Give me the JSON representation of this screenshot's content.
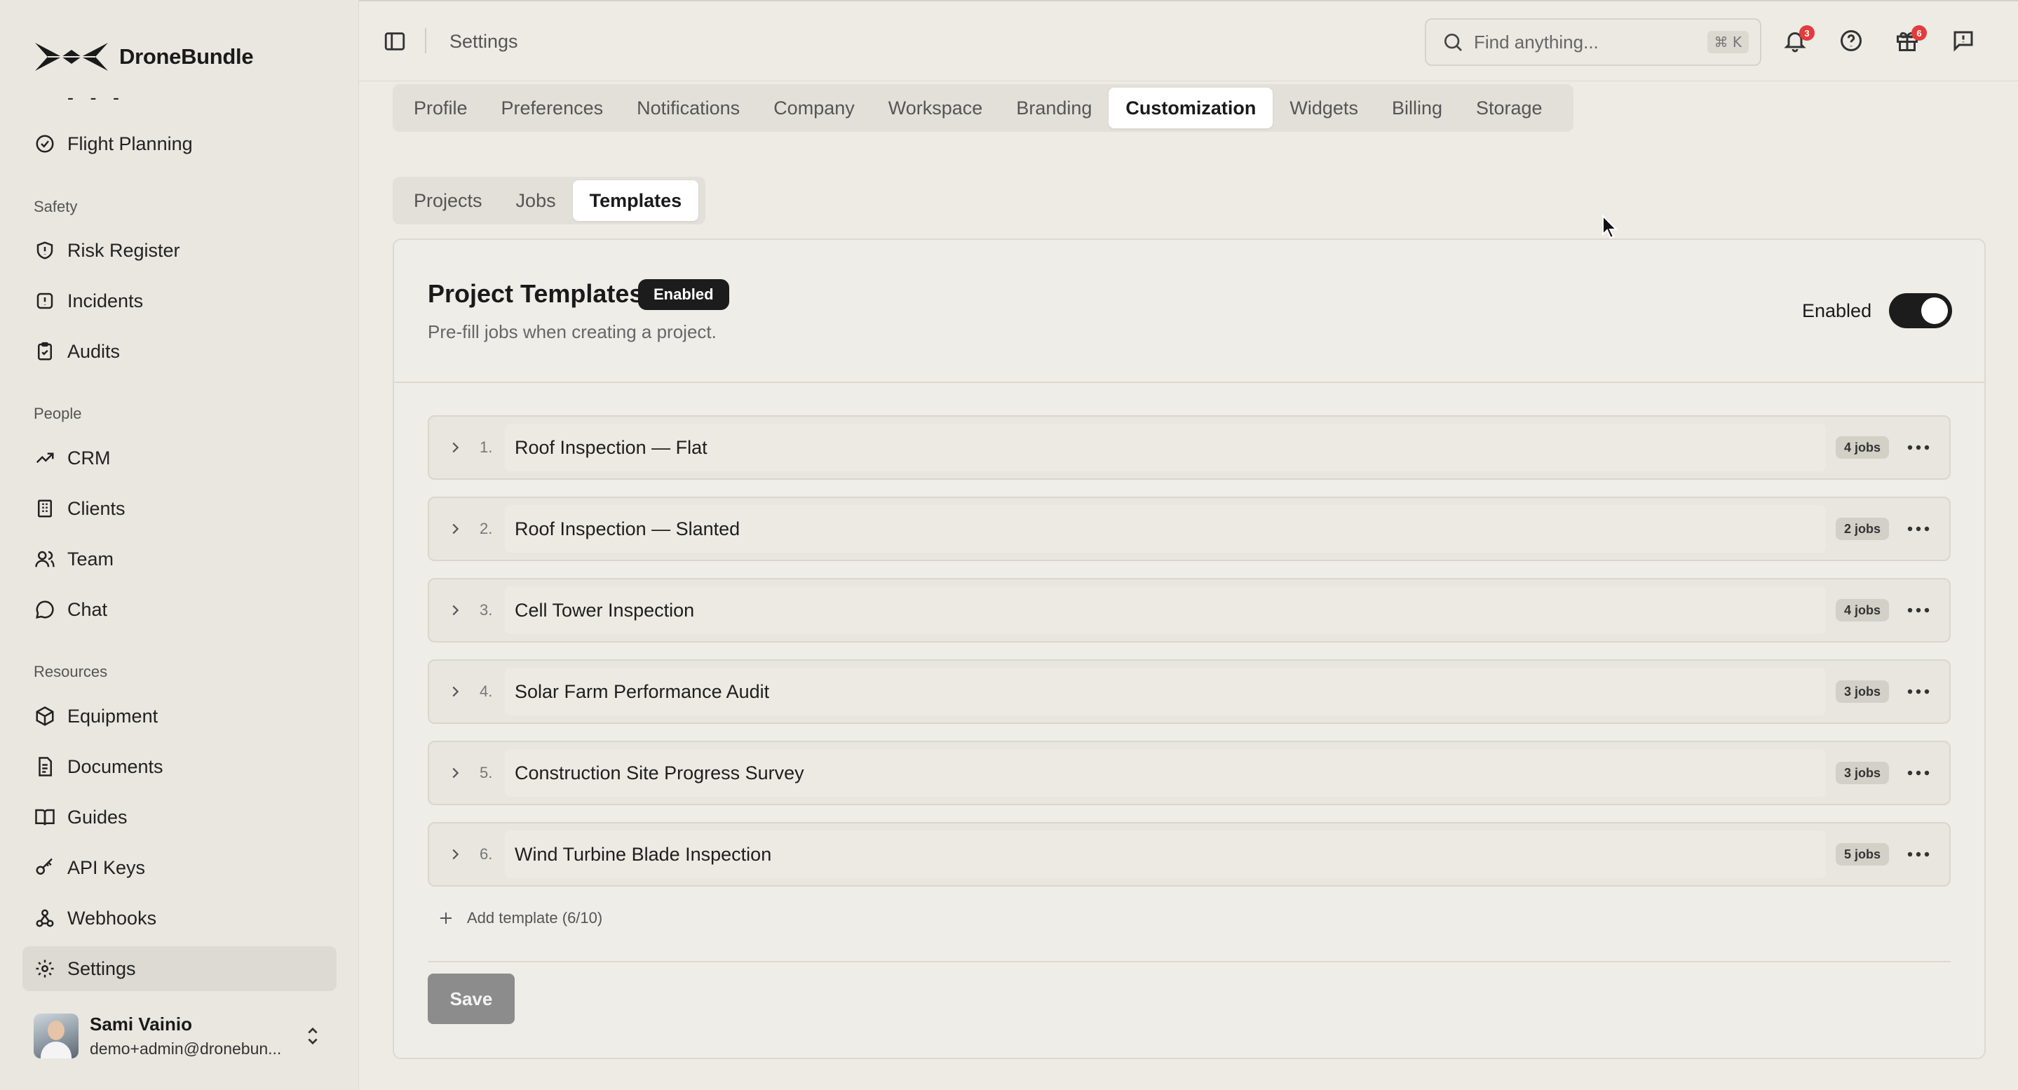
{
  "brand": {
    "name": "DroneBundle"
  },
  "sidebar": {
    "partial_item": "- - -",
    "items_top": [
      {
        "label": "Flight Planning",
        "icon": "checkmark-circle-icon"
      }
    ],
    "sections": [
      {
        "title": "Safety",
        "items": [
          {
            "label": "Risk Register",
            "icon": "shield-icon"
          },
          {
            "label": "Incidents",
            "icon": "alert-square-icon"
          },
          {
            "label": "Audits",
            "icon": "clipboard-check-icon"
          }
        ]
      },
      {
        "title": "People",
        "items": [
          {
            "label": "CRM",
            "icon": "trending-up-icon"
          },
          {
            "label": "Clients",
            "icon": "building-icon"
          },
          {
            "label": "Team",
            "icon": "users-icon"
          },
          {
            "label": "Chat",
            "icon": "chat-bubble-icon"
          }
        ]
      },
      {
        "title": "Resources",
        "items": [
          {
            "label": "Equipment",
            "icon": "package-icon"
          },
          {
            "label": "Documents",
            "icon": "document-icon"
          },
          {
            "label": "Guides",
            "icon": "book-icon"
          },
          {
            "label": "API Keys",
            "icon": "key-icon"
          },
          {
            "label": "Webhooks",
            "icon": "webhook-icon"
          },
          {
            "label": "Settings",
            "icon": "gear-icon",
            "active": true
          }
        ]
      }
    ],
    "user": {
      "name": "Sami Vainio",
      "email": "demo+admin@dronebun..."
    }
  },
  "topbar": {
    "title": "Settings",
    "search_placeholder": "Find anything...",
    "search_shortcut": "⌘ K",
    "notifications_count": "3",
    "gifts_count": "6"
  },
  "tabs": [
    "Profile",
    "Preferences",
    "Notifications",
    "Company",
    "Workspace",
    "Branding",
    "Customization",
    "Widgets",
    "Billing",
    "Storage"
  ],
  "active_tab": "Customization",
  "subtabs": [
    "Projects",
    "Jobs",
    "Templates"
  ],
  "active_subtab": "Templates",
  "card": {
    "title": "Project Templates",
    "status_pill": "Enabled",
    "description": "Pre-fill jobs when creating a project.",
    "toggle_label": "Enabled",
    "toggle_on": true,
    "templates": [
      {
        "index": "1.",
        "name": "Roof Inspection — Flat",
        "jobs": "4 jobs"
      },
      {
        "index": "2.",
        "name": "Roof Inspection — Slanted",
        "jobs": "2 jobs"
      },
      {
        "index": "3.",
        "name": "Cell Tower Inspection",
        "jobs": "4 jobs"
      },
      {
        "index": "4.",
        "name": "Solar Farm Performance Audit",
        "jobs": "3 jobs"
      },
      {
        "index": "5.",
        "name": "Construction Site Progress Survey",
        "jobs": "3 jobs"
      },
      {
        "index": "6.",
        "name": "Wind Turbine Blade Inspection",
        "jobs": "5 jobs"
      }
    ],
    "add_template_label": "Add template (6/10)",
    "save_label": "Save"
  },
  "colors": {
    "accent": "#1c1c1c",
    "badge": "#e23c3c",
    "background": "#edebe4"
  }
}
